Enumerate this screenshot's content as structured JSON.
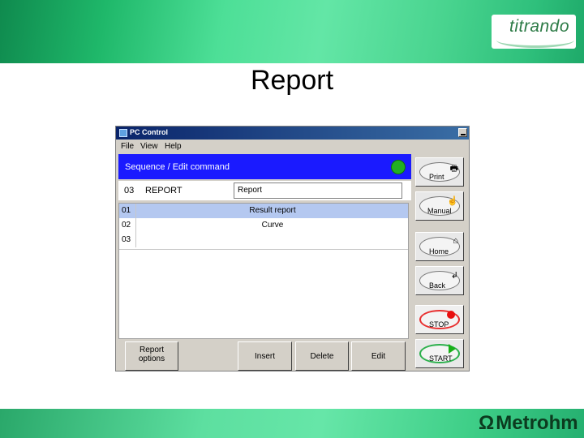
{
  "slide": {
    "title": "Report",
    "logo_text": "titrando",
    "brand_text": "Metrohm",
    "brand_symbol": "Ω"
  },
  "window": {
    "title": "PC Control",
    "menu": [
      "File",
      "View",
      "Help"
    ]
  },
  "header": {
    "text": "Sequence / Edit command",
    "status_color": "#22b022"
  },
  "command": {
    "number": "03",
    "name": "REPORT",
    "field_value": "Report"
  },
  "list": {
    "rows": [
      {
        "num": "01",
        "text": "Result report",
        "selected": true
      },
      {
        "num": "02",
        "text": "Curve",
        "selected": false
      },
      {
        "num": "03",
        "text": "",
        "selected": false
      }
    ]
  },
  "bottom_buttons": {
    "report_options_line1": "Report",
    "report_options_line2": "options",
    "insert": "Insert",
    "delete": "Delete",
    "edit": "Edit"
  },
  "side_buttons": {
    "print": "Print",
    "manual": "Manual",
    "home": "Home",
    "back": "Back",
    "stop": "STOP",
    "start": "START"
  },
  "colors": {
    "header_blue": "#1a1aff",
    "selected_row": "#b4c8f0",
    "stop_red": "#e81010",
    "start_green": "#18b018"
  }
}
